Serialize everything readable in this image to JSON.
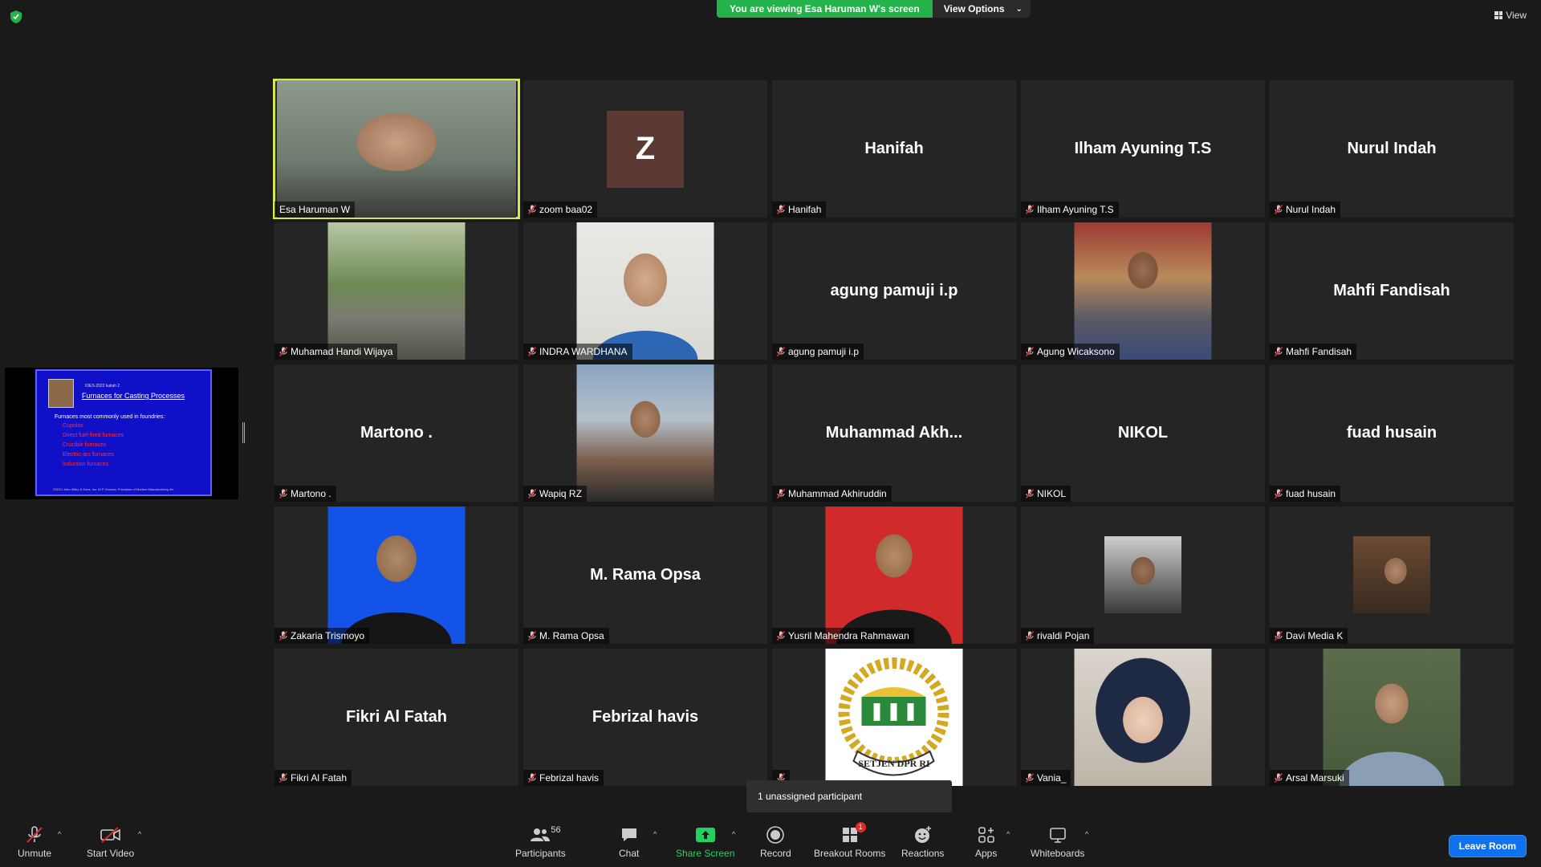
{
  "banner": {
    "viewing": "You are viewing Esa Haruman W's screen",
    "view_options": "View Options"
  },
  "top_right": {
    "view_label": "View"
  },
  "shared_slide": {
    "header": "IDES-2022 kuliah 2",
    "title": "Furnaces for Casting Processes",
    "lead": "Furnaces most commonly used in foundries:",
    "bullets": [
      "Cupolas",
      "Direct fuel-fired furnaces",
      "Crucible furnaces",
      "Electric-arc furnaces",
      "Induction furnaces"
    ],
    "footer": "©2010 John Wiley & Sons, Inc. M P Groover, Principles of Modern Manufacturing 4/e"
  },
  "participants": [
    {
      "name": "Esa Haruman W",
      "display": "",
      "kind": "photo",
      "muted": false,
      "speaking": true
    },
    {
      "name": "zoom baa02",
      "display": "Z",
      "kind": "avatar",
      "muted": true
    },
    {
      "name": "Hanifah",
      "display": "Hanifah",
      "kind": "name",
      "muted": true
    },
    {
      "name": "Ilham Ayuning T.S",
      "display": "Ilham Ayuning T.S",
      "kind": "name",
      "muted": true
    },
    {
      "name": "Nurul Indah",
      "display": "Nurul Indah",
      "kind": "name",
      "muted": true
    },
    {
      "name": "Muhamad Handi Wijaya",
      "display": "",
      "kind": "photo",
      "muted": true
    },
    {
      "name": "INDRA WARDHANA",
      "display": "",
      "kind": "photo",
      "muted": true
    },
    {
      "name": "agung pamuji i.p",
      "display": "agung pamuji i.p",
      "kind": "name",
      "muted": true
    },
    {
      "name": "Agung Wicaksono",
      "display": "",
      "kind": "photo",
      "muted": true
    },
    {
      "name": "Mahfi Fandisah",
      "display": "Mahfi Fandisah",
      "kind": "name",
      "muted": true
    },
    {
      "name": "Martono .",
      "display": "Martono .",
      "kind": "name",
      "muted": true
    },
    {
      "name": "Wapiq RZ",
      "display": "",
      "kind": "photo",
      "muted": true
    },
    {
      "name": "Muhammad Akhiruddin",
      "display": "Muhammad  Akh...",
      "kind": "name",
      "muted": true
    },
    {
      "name": "NIKOL",
      "display": "NIKOL",
      "kind": "name",
      "muted": true
    },
    {
      "name": "fuad husain",
      "display": "fuad husain",
      "kind": "name",
      "muted": true
    },
    {
      "name": "Zakaria Trismoyo",
      "display": "",
      "kind": "photo",
      "muted": true
    },
    {
      "name": "M. Rama Opsa",
      "display": "M. Rama Opsa",
      "kind": "name",
      "muted": true
    },
    {
      "name": "Yusril Mahendra Rahmawan",
      "display": "",
      "kind": "photo",
      "muted": true
    },
    {
      "name": "rivaldi Pojan",
      "display": "",
      "kind": "photo-small",
      "muted": true
    },
    {
      "name": "Davi Media K",
      "display": "",
      "kind": "photo-small",
      "muted": true
    },
    {
      "name": "Fikri Al Fatah",
      "display": "Fikri Al Fatah",
      "kind": "name",
      "muted": true
    },
    {
      "name": "Febrizal havis",
      "display": "Febrizal havis",
      "kind": "name",
      "muted": true
    },
    {
      "name": "",
      "display": "",
      "kind": "logo",
      "muted": true,
      "logo_text": "SETJEN DPR RI"
    },
    {
      "name": "Vania_",
      "display": "",
      "kind": "photo",
      "muted": true
    },
    {
      "name": "Arsal Marsuki",
      "display": "",
      "kind": "photo",
      "muted": true
    }
  ],
  "tooltip": "1 unassigned participant",
  "toolbar": {
    "unmute": "Unmute",
    "start_video": "Start Video",
    "participants": "Participants",
    "participants_count": "56",
    "chat": "Chat",
    "share_screen": "Share Screen",
    "record": "Record",
    "breakout_rooms": "Breakout Rooms",
    "breakout_badge": "1",
    "reactions": "Reactions",
    "apps": "Apps",
    "whiteboards": "Whiteboards",
    "leave": "Leave Room"
  },
  "colors": {
    "share_green": "#23b34a",
    "speaker_outline": "#d8e84a",
    "leave_blue": "#0e72ed",
    "mute_red": "#e02828"
  }
}
